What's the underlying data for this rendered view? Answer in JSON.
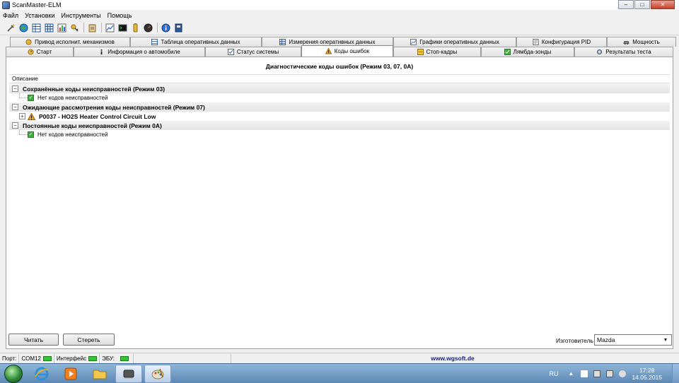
{
  "window": {
    "title": "ScanMaster-ELM",
    "minimize_glyph": "‒",
    "maximize_glyph": "□",
    "close_glyph": "✕"
  },
  "menu": [
    "Файл",
    "Установки",
    "Инструменты",
    "Помощь"
  ],
  "toolbar": {
    "icons": [
      "connect-icon",
      "globe-icon",
      "table-icon",
      "grid-icon",
      "chart-icon",
      "key-icon",
      "clipboard-icon",
      "graph-icon",
      "terminal-icon",
      "battery-icon",
      "gauge-icon",
      "info-icon",
      "help-icon"
    ]
  },
  "tabs": {
    "back_row": [
      "Привод исполнит. механизмов",
      "Таблица оперативных данных",
      "Измерения оперативных данных",
      "Графики оперативных данных",
      "Конфигурация PID",
      "Мощность"
    ],
    "front_row": [
      "Старт",
      "Информация о автомобиле",
      "Статус системы",
      "Коды ошибок",
      "Стоп-кадры",
      "Лямбда-зонды",
      "Результаты теста"
    ],
    "active": "Коды ошибок"
  },
  "panel": {
    "title": "Диагностические коды ошибок (Режим 03, 07, 0A)",
    "column_header": "Описание",
    "groups": [
      {
        "label": "Сохранённые коды неисправностей (Режим 03)",
        "expander": "−",
        "items": [
          {
            "type": "ok",
            "text": "Нет кодов неисправностей"
          }
        ]
      },
      {
        "label": "Ожидающие рассмотрения коды неисправностей (Режим 07)",
        "expander": "−",
        "items": [
          {
            "type": "dtc",
            "expander": "+",
            "text": "P0037 - HO2S Heater Control Circuit Low"
          }
        ]
      },
      {
        "label": "Постоянные коды неисправностей  (Режим 0A)",
        "expander": "−",
        "items": [
          {
            "type": "ok",
            "text": "Нет кодов неисправностей"
          }
        ]
      }
    ]
  },
  "buttons": {
    "read": "Читать",
    "clear": "Стереть"
  },
  "manufacturer": {
    "label": "Изготовитель",
    "value": "Mazda",
    "arrow": "▼"
  },
  "status": {
    "port_label": "Порт:",
    "port_value": "COM12",
    "interface_label": "Интерфейс",
    "ecu_label": "ЭБУ:",
    "website": "www.wgsoft.de",
    "led_color": "#2ec92e"
  },
  "taskbar": {
    "lang": "RU",
    "time": "17:28",
    "date": "14.05.2015",
    "apps": [
      "ie-icon",
      "media-player-icon",
      "folder-icon",
      "scanmaster-icon",
      "paint-icon"
    ]
  }
}
